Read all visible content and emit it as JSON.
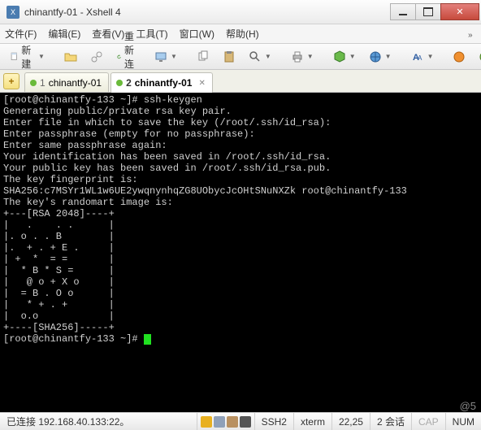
{
  "window": {
    "title": "chinantfy-01 - Xshell 4"
  },
  "menu": [
    "文件(F)",
    "编辑(E)",
    "查看(V)",
    "工具(T)",
    "窗口(W)",
    "帮助(H)"
  ],
  "toolbar": {
    "new_label": "新建",
    "reconnect_label": "重新连接"
  },
  "tabs": [
    {
      "num": "1",
      "label": "chinantfy-01",
      "active": false
    },
    {
      "num": "2",
      "label": "chinantfy-01",
      "active": true
    }
  ],
  "terminal": [
    "[root@chinantfy-133 ~]# ssh-keygen",
    "Generating public/private rsa key pair.",
    "Enter file in which to save the key (/root/.ssh/id_rsa):",
    "Enter passphrase (empty for no passphrase):",
    "Enter same passphrase again:",
    "Your identification has been saved in /root/.ssh/id_rsa.",
    "Your public key has been saved in /root/.ssh/id_rsa.pub.",
    "The key fingerprint is:",
    "SHA256:c7MSYr1WL1w6UE2ywqnynhqZG8UObycJcOHtSNuNXZk root@chinantfy-133",
    "The key's randomart image is:",
    "+---[RSA 2048]----+",
    "|   .    . .      |",
    "|. o . . B        |",
    "|.  + . + E .     |",
    "| +  *  = =       |",
    "|  * B * S =      |",
    "|   @ o + X o     |",
    "|  = B . O o      |",
    "|   * + . +       |",
    "|  o.o            |",
    "+----[SHA256]-----+",
    "[root@chinantfy-133 ~]# "
  ],
  "status": {
    "conn": "已连接 192.168.40.133:22。",
    "proto": "SSH2",
    "term": "xterm",
    "pos": "22,25",
    "sess": "2 会话",
    "cap": "CAP",
    "num": "NUM"
  },
  "watermark": "@5"
}
